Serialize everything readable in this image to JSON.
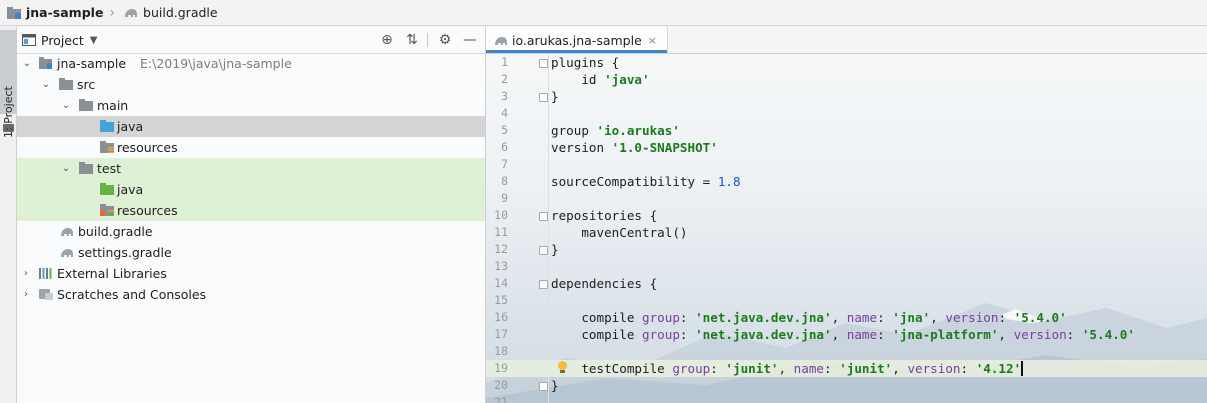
{
  "breadcrumb": [
    {
      "label": "jna-sample",
      "icon": "module-folder-icon"
    },
    {
      "label": "build.gradle",
      "icon": "gradle-icon"
    }
  ],
  "tool_strip": {
    "label": "1: Project"
  },
  "project_panel": {
    "title": "Project",
    "header_icons": [
      "locate-icon",
      "collapse-all-icon",
      "gear-icon",
      "minimize-icon"
    ],
    "tree": [
      {
        "label": "jna-sample",
        "hint": "E:\\2019\\java\\jna-sample",
        "depth": 0,
        "expanded": true,
        "icon": "module-folder-icon"
      },
      {
        "label": "src",
        "depth": 1,
        "expanded": true,
        "icon": "folder-icon"
      },
      {
        "label": "main",
        "depth": 2,
        "expanded": true,
        "icon": "folder-icon"
      },
      {
        "label": "java",
        "depth": 3,
        "icon": "source-folder-icon",
        "selected": true
      },
      {
        "label": "resources",
        "depth": 3,
        "icon": "resources-folder-icon"
      },
      {
        "label": "test",
        "depth": 2,
        "expanded": true,
        "icon": "folder-icon"
      },
      {
        "label": "java",
        "depth": 3,
        "icon": "test-source-folder-icon"
      },
      {
        "label": "resources",
        "depth": 3,
        "icon": "test-resources-folder-icon"
      },
      {
        "label": "build.gradle",
        "depth": 1,
        "icon": "gradle-icon"
      },
      {
        "label": "settings.gradle",
        "depth": 1,
        "icon": "gradle-icon"
      },
      {
        "label": "External Libraries",
        "depth": 0,
        "expanded": false,
        "icon": "libraries-icon"
      },
      {
        "label": "Scratches and Consoles",
        "depth": 0,
        "expanded": false,
        "icon": "scratches-icon"
      }
    ]
  },
  "editor": {
    "tab": {
      "label": "io.arukas.jna-sample",
      "close": "×"
    },
    "current_line": 19,
    "lines": [
      {
        "n": "1",
        "code": "plugins {"
      },
      {
        "n": "2",
        "code": "    id 'java'"
      },
      {
        "n": "3",
        "code": "}"
      },
      {
        "n": "4",
        "code": ""
      },
      {
        "n": "5",
        "code": "group 'io.arukas'"
      },
      {
        "n": "6",
        "code": "version '1.0-SNAPSHOT'"
      },
      {
        "n": "7",
        "code": ""
      },
      {
        "n": "8",
        "code": "sourceCompatibility = 1.8"
      },
      {
        "n": "9",
        "code": ""
      },
      {
        "n": "10",
        "code": "repositories {"
      },
      {
        "n": "11",
        "code": "    mavenCentral()"
      },
      {
        "n": "12",
        "code": "}"
      },
      {
        "n": "13",
        "code": ""
      },
      {
        "n": "14",
        "code": "dependencies {"
      },
      {
        "n": "15",
        "code": ""
      },
      {
        "n": "16",
        "code": "    compile group: 'net.java.dev.jna', name: 'jna', version: '5.4.0'"
      },
      {
        "n": "17",
        "code": "    compile group: 'net.java.dev.jna', name: 'jna-platform', version: '5.4.0'"
      },
      {
        "n": "18",
        "code": ""
      },
      {
        "n": "19",
        "code": "    testCompile group: 'junit', name: 'junit', version: '4.12'"
      },
      {
        "n": "20",
        "code": "}"
      },
      {
        "n": "21",
        "code": ""
      }
    ]
  },
  "colors": {
    "string": "#1d7a1d",
    "number": "#1750eb",
    "named_arg": "#7a3e9d",
    "selection": "#d4d4d6",
    "test_bg": "#d6eec8",
    "accent": "#4083c9"
  }
}
